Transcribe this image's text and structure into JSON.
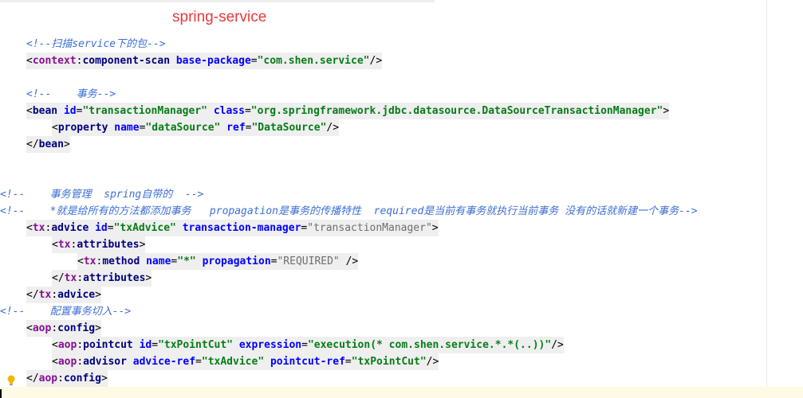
{
  "title": "spring-service",
  "comment_scan": "<!--扫描service下的包-->",
  "component_scan": {
    "ns": "context",
    "tag": "component-scan",
    "attr": "base-package",
    "value": "\"com.shen.service\""
  },
  "comment_tx": "<!--    事务-->",
  "bean": {
    "tag": "bean",
    "id_attr": "id",
    "id_value": "\"transactionManager\"",
    "class_attr": "class",
    "class_value": "\"org.springframework.jdbc.datasource.DataSourceTransactionManager\""
  },
  "property": {
    "tag": "property",
    "name_attr": "name",
    "name_value": "\"dataSource\"",
    "ref_attr": "ref",
    "ref_value": "\"DataSource\""
  },
  "bean_close": "bean",
  "comment_mgmt": "<!--    事务管理  spring自带的  -->",
  "comment_desc": "<!--    *就是给所有的方法都添加事务   propagation是事务的传播特性  required是当前有事务就执行当前事务 没有的话就新建一个事务-->",
  "advice": {
    "ns": "tx",
    "tag": "advice",
    "id_attr": "id",
    "id_value": "\"txAdvice\"",
    "tm_attr": "transaction-manager",
    "tm_value": "\"transactionManager\""
  },
  "attributes": {
    "ns": "tx",
    "tag": "attributes"
  },
  "method": {
    "ns": "tx",
    "tag": "method",
    "name_attr": "name",
    "name_value": "\"*\"",
    "prop_attr": "propagation",
    "prop_value": "\"REQUIRED\""
  },
  "attributes_close": {
    "ns": "tx",
    "tag": "attributes"
  },
  "advice_close": {
    "ns": "tx",
    "tag": "advice"
  },
  "comment_aop": "<!--    配置事务切入-->",
  "aop_config": {
    "ns": "aop",
    "tag": "config"
  },
  "pointcut": {
    "ns": "aop",
    "tag": "pointcut",
    "id_attr": "id",
    "id_value": "\"txPointCut\"",
    "expr_attr": "expression",
    "expr_value": "\"execution(* com.shen.service.*.*(..))\""
  },
  "advisor": {
    "ns": "aop",
    "tag": "advisor",
    "ref_attr": "advice-ref",
    "ref_value": "\"txAdvice\"",
    "pc_attr": "pointcut-ref",
    "pc_value": "\"txPointCut\""
  },
  "aop_close": {
    "ns": "aop",
    "tag": "config"
  },
  "icons": {
    "intention": "lightbulb-icon"
  },
  "colors": {
    "title": "#e8393b",
    "comment": "#3d6fd6",
    "tag": "#000080",
    "namespace": "#871094",
    "attribute": "#0000ff",
    "string": "#067d17"
  }
}
